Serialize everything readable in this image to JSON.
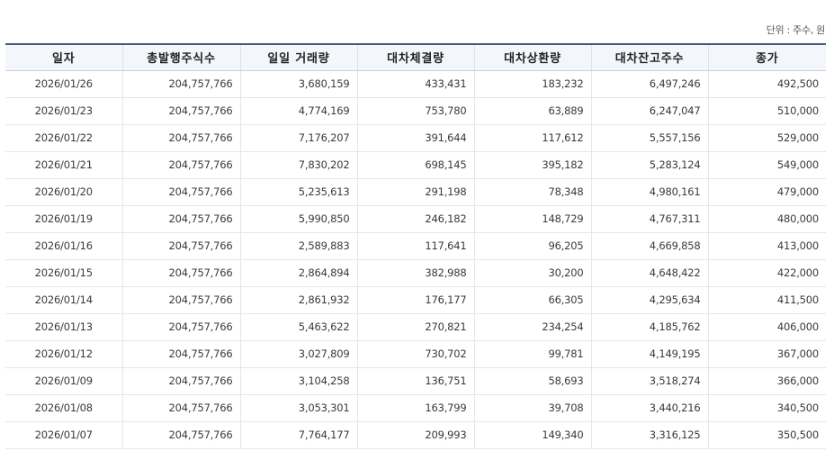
{
  "unit_caption": "단위 : 주수, 원",
  "table": {
    "headers": [
      "일자",
      "총발행주식수",
      "일일 거래량",
      "대차체결량",
      "대차상환량",
      "대차잔고주수",
      "종가"
    ],
    "rows": [
      [
        "2026/01/26",
        "204,757,766",
        "3,680,159",
        "433,431",
        "183,232",
        "6,497,246",
        "492,500"
      ],
      [
        "2026/01/23",
        "204,757,766",
        "4,774,169",
        "753,780",
        "63,889",
        "6,247,047",
        "510,000"
      ],
      [
        "2026/01/22",
        "204,757,766",
        "7,176,207",
        "391,644",
        "117,612",
        "5,557,156",
        "529,000"
      ],
      [
        "2026/01/21",
        "204,757,766",
        "7,830,202",
        "698,145",
        "395,182",
        "5,283,124",
        "549,000"
      ],
      [
        "2026/01/20",
        "204,757,766",
        "5,235,613",
        "291,198",
        "78,348",
        "4,980,161",
        "479,000"
      ],
      [
        "2026/01/19",
        "204,757,766",
        "5,990,850",
        "246,182",
        "148,729",
        "4,767,311",
        "480,000"
      ],
      [
        "2026/01/16",
        "204,757,766",
        "2,589,883",
        "117,641",
        "96,205",
        "4,669,858",
        "413,000"
      ],
      [
        "2026/01/15",
        "204,757,766",
        "2,864,894",
        "382,988",
        "30,200",
        "4,648,422",
        "422,000"
      ],
      [
        "2026/01/14",
        "204,757,766",
        "2,861,932",
        "176,177",
        "66,305",
        "4,295,634",
        "411,500"
      ],
      [
        "2026/01/13",
        "204,757,766",
        "5,463,622",
        "270,821",
        "234,254",
        "4,185,762",
        "406,000"
      ],
      [
        "2026/01/12",
        "204,757,766",
        "3,027,809",
        "730,702",
        "99,781",
        "4,149,195",
        "367,000"
      ],
      [
        "2026/01/09",
        "204,757,766",
        "3,104,258",
        "136,751",
        "58,693",
        "3,518,274",
        "366,000"
      ],
      [
        "2026/01/08",
        "204,757,766",
        "3,053,301",
        "163,799",
        "39,708",
        "3,440,216",
        "340,500"
      ],
      [
        "2026/01/07",
        "204,757,766",
        "7,764,177",
        "209,993",
        "149,340",
        "3,316,125",
        "350,500"
      ]
    ]
  }
}
